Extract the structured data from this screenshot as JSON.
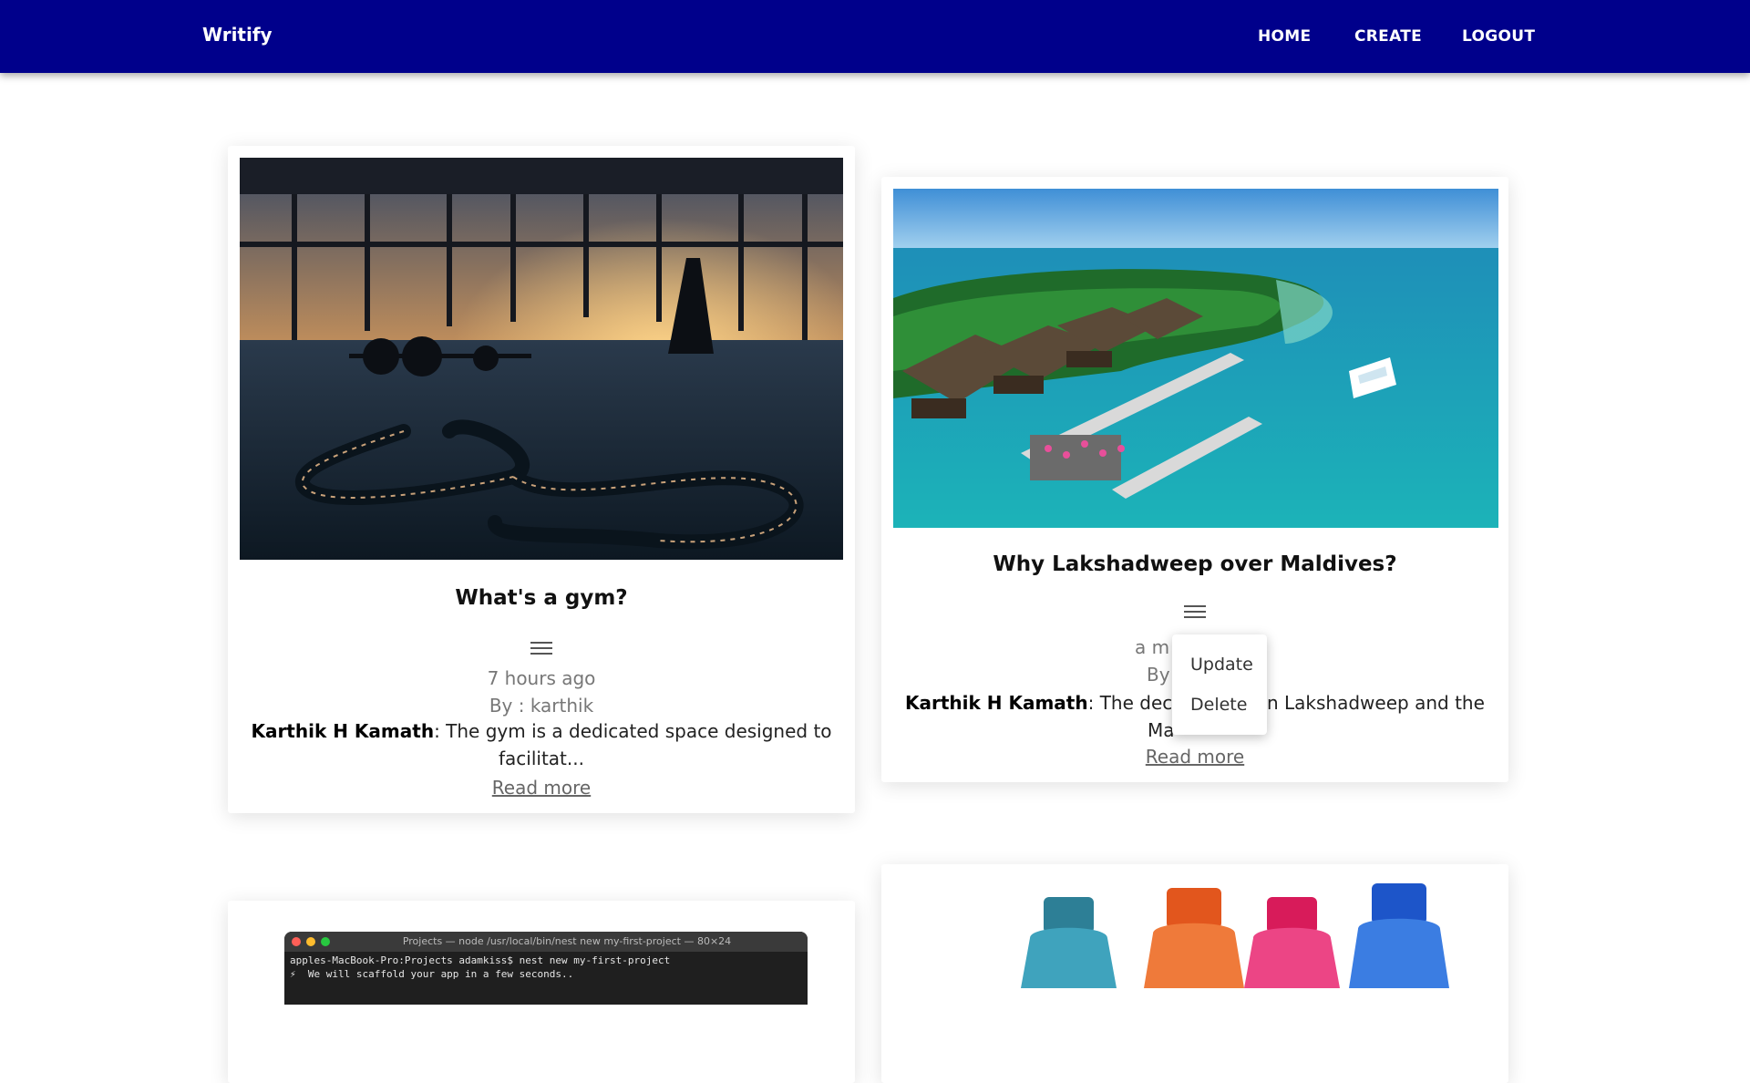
{
  "navbar": {
    "brand": "Writify",
    "links": [
      "HOME",
      "CREATE",
      "LOGOUT"
    ],
    "background": "#00008b"
  },
  "posts": [
    {
      "title": "What's a gym?",
      "time_ago": "7 hours ago",
      "author_line": "By : karthik",
      "excerpt_author": "Karthik H Kamath",
      "excerpt_text": ": The gym is a dedicated space designed to facilitat...",
      "read_more": "Read more",
      "image": "gym with battle ropes at sunset"
    },
    {
      "title": "Why Lakshadweep over Maldives?",
      "time_ago_partial": "a m",
      "author_line_partial": "By",
      "excerpt_author": "Karthik H Kamath",
      "excerpt_text_partial_left": ": The decisi",
      "excerpt_text_partial_right": "n Lakshadweep and the",
      "excerpt_line2_partial": "Ma",
      "read_more": "Read more",
      "image": "tropical island resort aerial"
    },
    {
      "image": "terminal window",
      "terminal": {
        "title": "Projects — node /usr/local/bin/nest new my-first-project — 80×24",
        "line1": "apples-MacBook-Pro:Projects adamkiss$ nest new my-first-project",
        "line2": "⚡  We will scaffold your app in a few seconds.."
      }
    },
    {
      "image": "colorful water bottles"
    }
  ],
  "dropdown": {
    "items": [
      "Update",
      "Delete"
    ]
  }
}
